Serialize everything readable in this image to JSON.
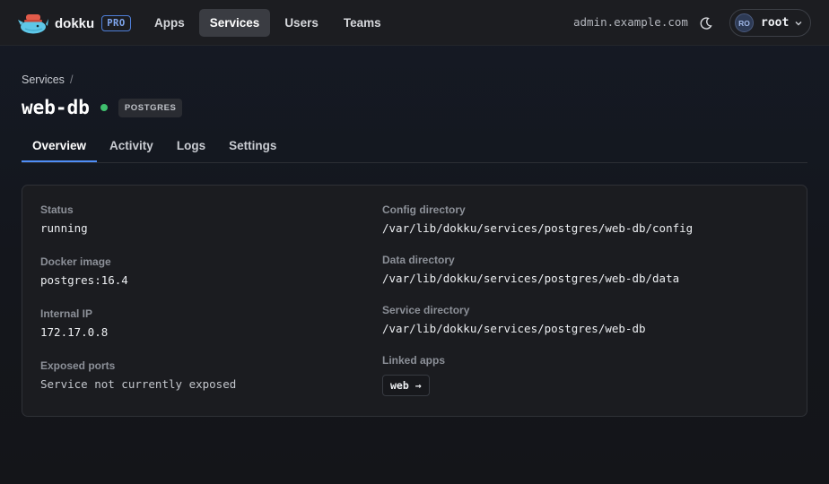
{
  "brand": {
    "name": "dokku",
    "badge": "PRO"
  },
  "nav": [
    {
      "label": "Apps",
      "active": false
    },
    {
      "label": "Services",
      "active": true
    },
    {
      "label": "Users",
      "active": false
    },
    {
      "label": "Teams",
      "active": false
    }
  ],
  "header": {
    "host": "admin.example.com",
    "user": {
      "initials": "RO",
      "name": "root"
    }
  },
  "breadcrumb": {
    "parent": "Services",
    "separator": "/"
  },
  "service": {
    "name": "web-db",
    "type": "POSTGRES",
    "status_color": "#3fbf6e"
  },
  "tabs": [
    {
      "label": "Overview",
      "active": true
    },
    {
      "label": "Activity",
      "active": false
    },
    {
      "label": "Logs",
      "active": false
    },
    {
      "label": "Settings",
      "active": false
    }
  ],
  "details": {
    "status": {
      "label": "Status",
      "value": "running"
    },
    "docker_image": {
      "label": "Docker image",
      "value": "postgres:16.4"
    },
    "internal_ip": {
      "label": "Internal IP",
      "value": "172.17.0.8"
    },
    "exposed_ports": {
      "label": "Exposed ports",
      "value": "Service not currently exposed"
    },
    "config_dir": {
      "label": "Config directory",
      "value": "/var/lib/dokku/services/postgres/web-db/config"
    },
    "data_dir": {
      "label": "Data directory",
      "value": "/var/lib/dokku/services/postgres/web-db/data"
    },
    "service_dir": {
      "label": "Service directory",
      "value": "/var/lib/dokku/services/postgres/web-db"
    },
    "linked_apps": {
      "label": "Linked apps",
      "items": [
        "web →"
      ]
    }
  },
  "colors": {
    "accent": "#4f8ef7",
    "running": "#3fbf6e"
  }
}
